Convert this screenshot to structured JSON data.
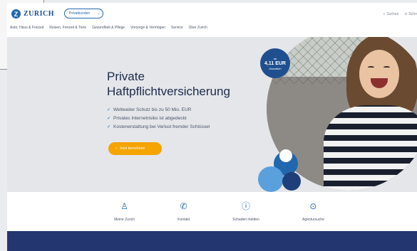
{
  "header": {
    "logo_text": "ZURICH",
    "logo_letter": "Z",
    "audience_select": "Privatkunden",
    "search_label": "Suchen",
    "account_label": "Schn"
  },
  "nav": {
    "items": [
      "Auto, Haus & Freizeit",
      "Reisen, Freizeit & Tiere",
      "Gesundheit & Pflege",
      "Vorsorge & Vermögen",
      "Service",
      "Über Zurich"
    ]
  },
  "hero": {
    "title": "Private Haftpflichtversicherung",
    "benefits": [
      "Weltweiter Schutz bis zu 50 Mio. EUR",
      "Privates Internetrisiko ist abgedeckt",
      "Kostenerstattung bei Verlust fremder Schlüssel"
    ],
    "cta_label": "Jetzt berechnen",
    "badge": {
      "line1": "ab",
      "price": "4,11 EUR",
      "line3": "Monatlich"
    }
  },
  "quicklinks": [
    {
      "icon": "person-icon",
      "glyph": "♙",
      "label": "Meine Zurich"
    },
    {
      "icon": "phone-icon",
      "glyph": "✆",
      "label": "Kontakt"
    },
    {
      "icon": "alert-icon",
      "glyph": "ⓘ",
      "label": "Schaden melden"
    },
    {
      "icon": "location-pin-icon",
      "glyph": "⊙",
      "label": "Agentursuche"
    }
  ],
  "colors": {
    "brand_blue": "#2167ae",
    "cta_orange": "#f5a400",
    "footer_navy": "#23366f"
  }
}
